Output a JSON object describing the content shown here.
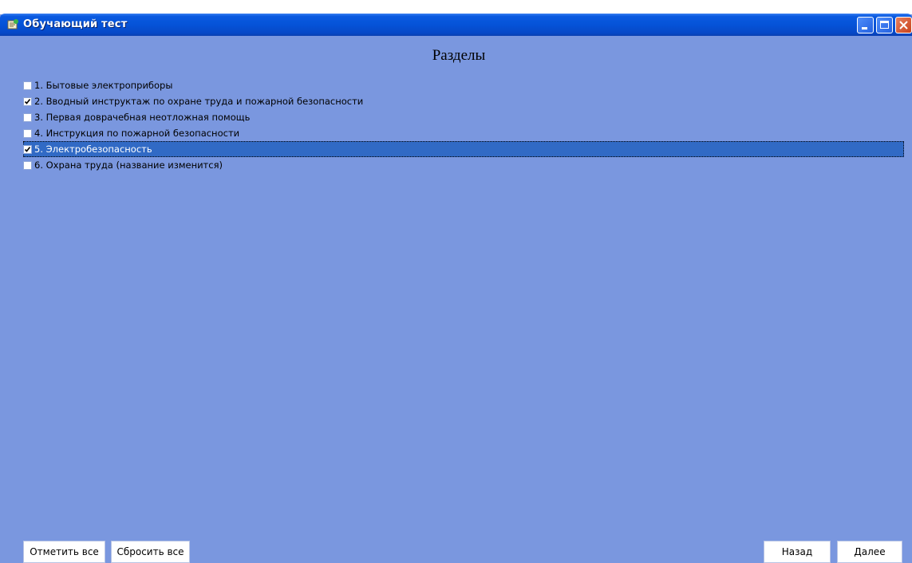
{
  "window": {
    "title": "Обучающий тест"
  },
  "heading": "Разделы",
  "sections": [
    {
      "label": "1. Бытовые электроприборы",
      "checked": false,
      "selected": false
    },
    {
      "label": "2. Вводный инструктаж по охране труда и пожарной безопасности",
      "checked": true,
      "selected": false
    },
    {
      "label": "3. Первая доврачебная неотложная помощь",
      "checked": false,
      "selected": false
    },
    {
      "label": "4. Инструкция по пожарной безопасности",
      "checked": false,
      "selected": false
    },
    {
      "label": "5. Электробезопасность",
      "checked": true,
      "selected": true
    },
    {
      "label": "6. Охрана труда (название изменится)",
      "checked": false,
      "selected": false
    }
  ],
  "buttons": {
    "select_all": "Отметить все",
    "reset_all": "Сбросить все",
    "back": "Назад",
    "next": "Далее"
  },
  "colors": {
    "background": "#7a97df",
    "selection": "#316ac5",
    "titlebar": "#0553d8"
  }
}
